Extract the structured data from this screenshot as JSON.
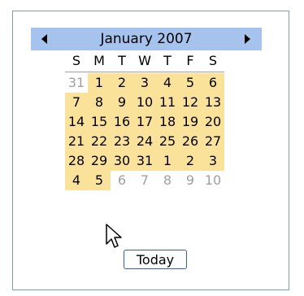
{
  "calendar": {
    "title": "January 2007",
    "weekdays": [
      "S",
      "M",
      "T",
      "W",
      "T",
      "F",
      "S"
    ],
    "weeks": [
      [
        {
          "d": "31",
          "m": "prev"
        },
        {
          "d": "1",
          "m": "cur"
        },
        {
          "d": "2",
          "m": "cur"
        },
        {
          "d": "3",
          "m": "cur"
        },
        {
          "d": "4",
          "m": "cur"
        },
        {
          "d": "5",
          "m": "cur"
        },
        {
          "d": "6",
          "m": "cur"
        }
      ],
      [
        {
          "d": "7",
          "m": "cur"
        },
        {
          "d": "8",
          "m": "cur"
        },
        {
          "d": "9",
          "m": "cur"
        },
        {
          "d": "10",
          "m": "cur"
        },
        {
          "d": "11",
          "m": "cur"
        },
        {
          "d": "12",
          "m": "cur"
        },
        {
          "d": "13",
          "m": "cur"
        }
      ],
      [
        {
          "d": "14",
          "m": "cur"
        },
        {
          "d": "15",
          "m": "cur"
        },
        {
          "d": "16",
          "m": "cur"
        },
        {
          "d": "17",
          "m": "cur"
        },
        {
          "d": "18",
          "m": "cur"
        },
        {
          "d": "19",
          "m": "cur"
        },
        {
          "d": "20",
          "m": "cur"
        }
      ],
      [
        {
          "d": "21",
          "m": "cur"
        },
        {
          "d": "22",
          "m": "cur"
        },
        {
          "d": "23",
          "m": "cur"
        },
        {
          "d": "24",
          "m": "cur"
        },
        {
          "d": "25",
          "m": "cur"
        },
        {
          "d": "26",
          "m": "cur"
        },
        {
          "d": "27",
          "m": "cur"
        }
      ],
      [
        {
          "d": "28",
          "m": "cur"
        },
        {
          "d": "29",
          "m": "cur"
        },
        {
          "d": "30",
          "m": "cur"
        },
        {
          "d": "31",
          "m": "cur"
        },
        {
          "d": "1",
          "m": "next-hl"
        },
        {
          "d": "2",
          "m": "next-hl"
        },
        {
          "d": "3",
          "m": "next-hl"
        }
      ],
      [
        {
          "d": "4",
          "m": "next-hl"
        },
        {
          "d": "5",
          "m": "next-hl"
        },
        {
          "d": "6",
          "m": "next"
        },
        {
          "d": "7",
          "m": "next"
        },
        {
          "d": "8",
          "m": "next"
        },
        {
          "d": "9",
          "m": "next"
        },
        {
          "d": "10",
          "m": "next"
        }
      ]
    ],
    "today_button_label": "Today",
    "colors": {
      "title_bar": "#a6c3ee",
      "month_highlight": "#fbe29a",
      "other_month_text": "#a0a0a0"
    }
  },
  "icons": {
    "prev": "triangle-left-icon",
    "next": "triangle-right-icon",
    "pointer": "mouse-pointer-icon"
  }
}
